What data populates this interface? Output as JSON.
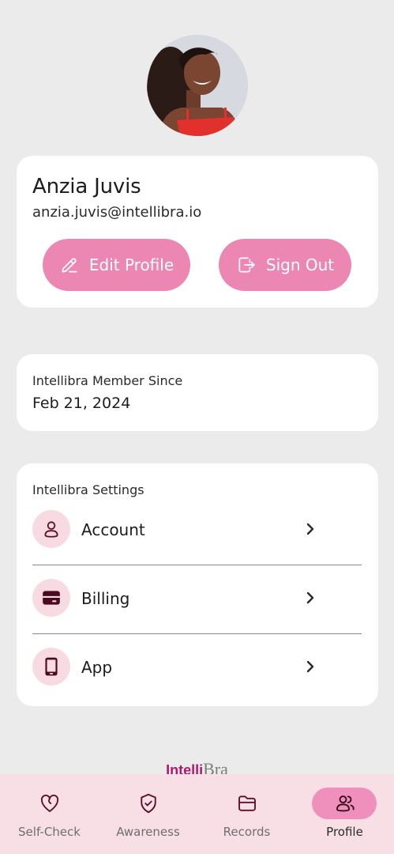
{
  "profile": {
    "name": "Anzia Juvis",
    "email": "anzia.juvis@intellibra.io",
    "edit_label": "Edit Profile",
    "signout_label": "Sign Out"
  },
  "membership": {
    "label": "Intellibra Member Since",
    "date": "Feb 21, 2024"
  },
  "settings": {
    "title": "Intellibra Settings",
    "items": [
      {
        "label": "Account",
        "icon": "user-icon"
      },
      {
        "label": "Billing",
        "icon": "card-icon"
      },
      {
        "label": "App",
        "icon": "phone-icon"
      }
    ]
  },
  "brand": {
    "part1": "Intelli",
    "part2": "Bra"
  },
  "tabs": [
    {
      "label": "Self-Check",
      "icon": "heart-icon"
    },
    {
      "label": "Awareness",
      "icon": "shield-check-icon"
    },
    {
      "label": "Records",
      "icon": "folder-icon"
    },
    {
      "label": "Profile",
      "icon": "users-icon",
      "active": true
    }
  ],
  "colors": {
    "accent": "#ec87b3",
    "icon_bg": "#f8dbe2",
    "tabbar_bg": "#f7dfe5",
    "brand": "#b2186a"
  }
}
